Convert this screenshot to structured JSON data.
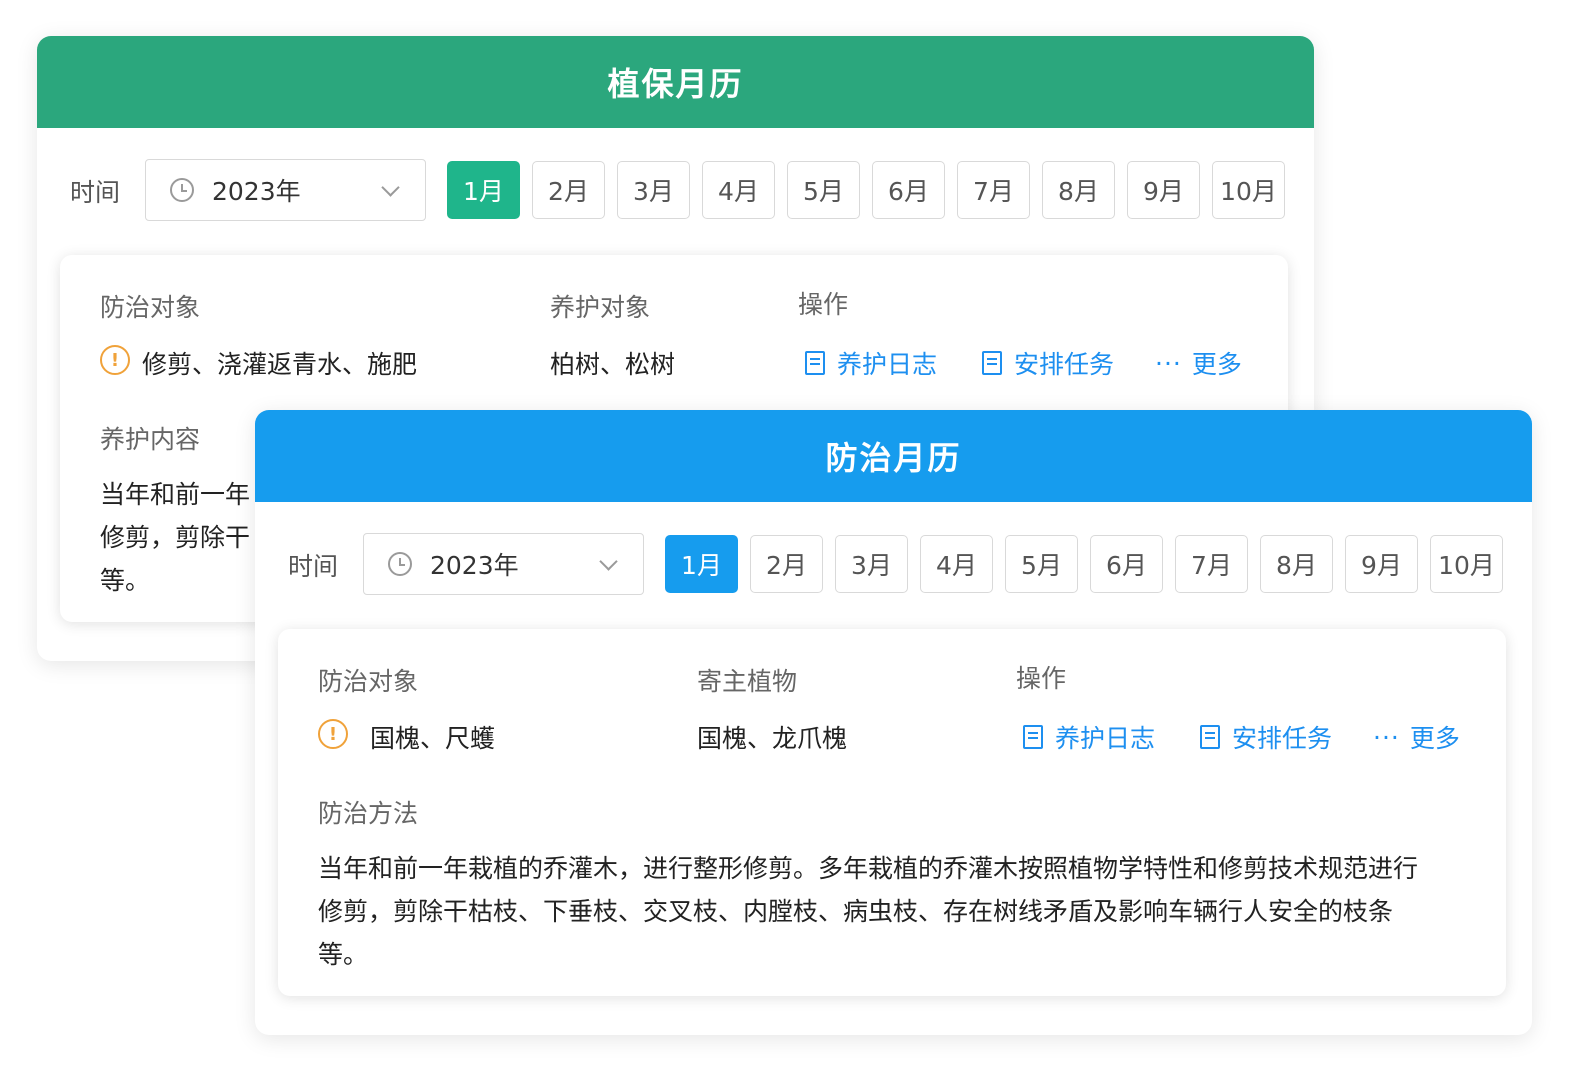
{
  "plant_calendar": {
    "title": "植保月历",
    "time_label": "时间",
    "year": "2023年",
    "months": [
      "1月",
      "2月",
      "3月",
      "4月",
      "5月",
      "6月",
      "7月",
      "8月",
      "9月",
      "10月"
    ],
    "active_month": "1月",
    "target_label": "防治对象",
    "target_value": "修剪、浇灌返青水、施肥",
    "object_label": "养护对象",
    "object_value": "柏树、松树",
    "ops_label": "操作",
    "actions": {
      "log": "养护日志",
      "task": "安排任务",
      "more": "更多"
    },
    "content_label": "养护内容",
    "content_lines": [
      "当年和前一年",
      "修剪，剪除干",
      "等。"
    ],
    "accent_color": "#2ba77d"
  },
  "control_calendar": {
    "title": "防治月历",
    "time_label": "时间",
    "year": "2023年",
    "months": [
      "1月",
      "2月",
      "3月",
      "4月",
      "5月",
      "6月",
      "7月",
      "8月",
      "9月",
      "10月"
    ],
    "active_month": "1月",
    "target_label": "防治对象",
    "target_value": "国槐、尺蠖",
    "host_label": "寄主植物",
    "host_value": "国槐、龙爪槐",
    "ops_label": "操作",
    "actions": {
      "log": "养护日志",
      "task": "安排任务",
      "more": "更多"
    },
    "method_label": "防治方法",
    "method_lines": [
      "当年和前一年栽植的乔灌木，进行整形修剪。多年栽植的乔灌木按照植物学特性和修剪技术规范进行",
      "修剪，剪除干枯枝、下垂枝、交叉枝、内膛枝、病虫枝、存在树线矛盾及影响车辆行人安全的枝条",
      "等。"
    ],
    "accent_color": "#169cee"
  },
  "icons": [
    "clock-icon",
    "chevron-down-icon",
    "warning-icon",
    "document-edit-icon",
    "more-dots-icon"
  ]
}
